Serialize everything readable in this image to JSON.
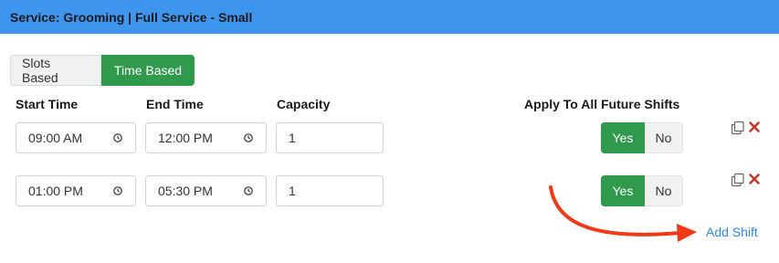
{
  "header": {
    "title": "Service: Grooming | Full Service - Small"
  },
  "mode_toggle": {
    "options": [
      "Slots Based",
      "Time Based"
    ],
    "selected": "Time Based"
  },
  "columns": {
    "start": "Start Time",
    "end": "End Time",
    "capacity": "Capacity",
    "apply": "Apply To All Future Shifts"
  },
  "shifts": [
    {
      "start": "09:00 AM",
      "end": "12:00 PM",
      "capacity": "1",
      "apply_yes": "Yes",
      "apply_no": "No",
      "apply_selected": "Yes"
    },
    {
      "start": "01:00 PM",
      "end": "05:30 PM",
      "capacity": "1",
      "apply_yes": "Yes",
      "apply_no": "No",
      "apply_selected": "Yes"
    }
  ],
  "add_shift_label": "Add Shift",
  "icons": {
    "copy": "copy-icon",
    "delete": "close-icon",
    "clock": "clock-icon",
    "annotation": "arrow-annotation"
  },
  "colors": {
    "header": "#3d95ee",
    "accent_green": "#2f9a4c",
    "delete_red": "#c0392b",
    "link_blue": "#2d8ae6",
    "arrow_red": "#f03a17"
  }
}
